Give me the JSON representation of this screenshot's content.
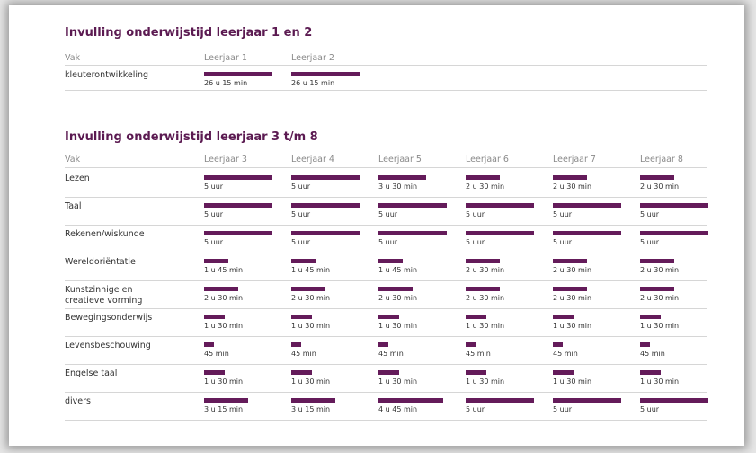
{
  "section1": {
    "title": "Invulling onderwijstijd leerjaar 1 en 2",
    "headers": [
      "Vak",
      "Leerjaar 1",
      "Leerjaar 2"
    ],
    "rows": [
      {
        "subject": [
          "kleuterontwikkeling"
        ],
        "values": [
          {
            "label": "26 u 15 min",
            "fill": 1
          },
          {
            "label": "26 u 15 min",
            "fill": 1
          }
        ]
      }
    ]
  },
  "section2": {
    "title": "Invulling onderwijstijd leerjaar 3 t/m 8",
    "headers": [
      "Vak",
      "Leerjaar 3",
      "Leerjaar 4",
      "Leerjaar 5",
      "Leerjaar 6",
      "Leerjaar 7",
      "Leerjaar 8"
    ],
    "rows": [
      {
        "subject": [
          "Lezen"
        ],
        "values": [
          {
            "label": "5 uur",
            "fill": 1
          },
          {
            "label": "5 uur",
            "fill": 1
          },
          {
            "label": "3 u 30 min",
            "fill": 0.7
          },
          {
            "label": "2 u 30 min",
            "fill": 0.5
          },
          {
            "label": "2 u 30 min",
            "fill": 0.5
          },
          {
            "label": "2 u 30 min",
            "fill": 0.5
          }
        ]
      },
      {
        "subject": [
          "Taal"
        ],
        "values": [
          {
            "label": "5 uur",
            "fill": 1
          },
          {
            "label": "5 uur",
            "fill": 1
          },
          {
            "label": "5 uur",
            "fill": 1
          },
          {
            "label": "5 uur",
            "fill": 1
          },
          {
            "label": "5 uur",
            "fill": 1
          },
          {
            "label": "5 uur",
            "fill": 1
          }
        ]
      },
      {
        "subject": [
          "Rekenen/wiskunde"
        ],
        "values": [
          {
            "label": "5 uur",
            "fill": 1
          },
          {
            "label": "5 uur",
            "fill": 1
          },
          {
            "label": "5 uur",
            "fill": 1
          },
          {
            "label": "5 uur",
            "fill": 1
          },
          {
            "label": "5 uur",
            "fill": 1
          },
          {
            "label": "5 uur",
            "fill": 1
          }
        ]
      },
      {
        "subject": [
          "Wereldoriëntatie"
        ],
        "values": [
          {
            "label": "1 u 45 min",
            "fill": 0.35
          },
          {
            "label": "1 u 45 min",
            "fill": 0.35
          },
          {
            "label": "1 u 45 min",
            "fill": 0.35
          },
          {
            "label": "2 u 30 min",
            "fill": 0.5
          },
          {
            "label": "2 u 30 min",
            "fill": 0.5
          },
          {
            "label": "2 u 30 min",
            "fill": 0.5
          }
        ]
      },
      {
        "subject": [
          "Kunstzinnige en",
          "creatieve vorming"
        ],
        "values": [
          {
            "label": "2 u 30 min",
            "fill": 0.5
          },
          {
            "label": "2 u 30 min",
            "fill": 0.5
          },
          {
            "label": "2 u 30 min",
            "fill": 0.5
          },
          {
            "label": "2 u 30 min",
            "fill": 0.5
          },
          {
            "label": "2 u 30 min",
            "fill": 0.5
          },
          {
            "label": "2 u 30 min",
            "fill": 0.5
          }
        ]
      },
      {
        "subject": [
          "Bewegingsonderwijs"
        ],
        "values": [
          {
            "label": "1 u 30 min",
            "fill": 0.3
          },
          {
            "label": "1 u 30 min",
            "fill": 0.3
          },
          {
            "label": "1 u 30 min",
            "fill": 0.3
          },
          {
            "label": "1 u 30 min",
            "fill": 0.3
          },
          {
            "label": "1 u 30 min",
            "fill": 0.3
          },
          {
            "label": "1 u 30 min",
            "fill": 0.3
          }
        ]
      },
      {
        "subject": [
          "Levensbeschouwing"
        ],
        "values": [
          {
            "label": "45 min",
            "fill": 0.15
          },
          {
            "label": "45 min",
            "fill": 0.15
          },
          {
            "label": "45 min",
            "fill": 0.15
          },
          {
            "label": "45 min",
            "fill": 0.15
          },
          {
            "label": "45 min",
            "fill": 0.15
          },
          {
            "label": "45 min",
            "fill": 0.15
          }
        ]
      },
      {
        "subject": [
          "Engelse taal"
        ],
        "values": [
          {
            "label": "1 u 30 min",
            "fill": 0.3
          },
          {
            "label": "1 u 30 min",
            "fill": 0.3
          },
          {
            "label": "1 u 30 min",
            "fill": 0.3
          },
          {
            "label": "1 u 30 min",
            "fill": 0.3
          },
          {
            "label": "1 u 30 min",
            "fill": 0.3
          },
          {
            "label": "1 u 30 min",
            "fill": 0.3
          }
        ]
      },
      {
        "subject": [
          "divers"
        ],
        "values": [
          {
            "label": "3 u 15 min",
            "fill": 0.65
          },
          {
            "label": "3 u 15 min",
            "fill": 0.65
          },
          {
            "label": "4 u 45 min",
            "fill": 0.95
          },
          {
            "label": "5 uur",
            "fill": 1
          },
          {
            "label": "5 uur",
            "fill": 1
          },
          {
            "label": "5 uur",
            "fill": 1
          }
        ]
      }
    ]
  },
  "colors": {
    "bar": "#641b5a",
    "title": "#5b1a51"
  }
}
